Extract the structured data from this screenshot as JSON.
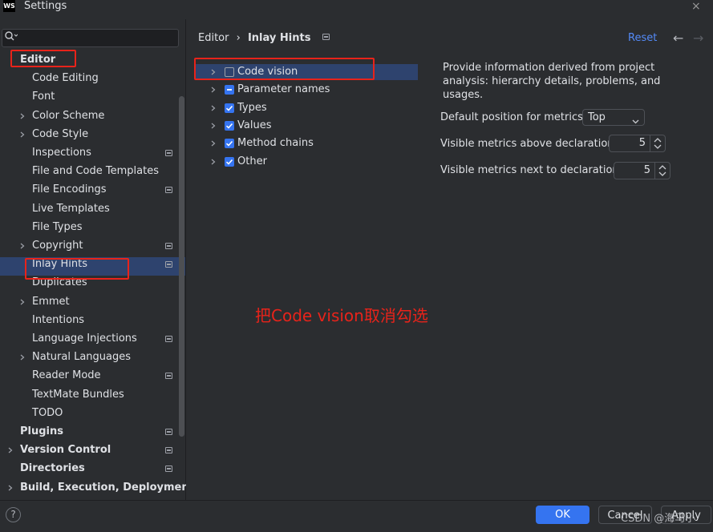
{
  "window": {
    "title": "Settings",
    "logo_text": "WS"
  },
  "search": {
    "placeholder": ""
  },
  "sidebar": {
    "items": [
      {
        "label": "Editor",
        "bold": true,
        "chevron": false,
        "badge": false
      },
      {
        "label": "Code Editing",
        "chevron": false,
        "badge": false
      },
      {
        "label": "Font",
        "chevron": false,
        "badge": false
      },
      {
        "label": "Color Scheme",
        "chevron": true,
        "badge": false
      },
      {
        "label": "Code Style",
        "chevron": true,
        "badge": false
      },
      {
        "label": "Inspections",
        "chevron": false,
        "badge": true
      },
      {
        "label": "File and Code Templates",
        "chevron": false,
        "badge": false
      },
      {
        "label": "File Encodings",
        "chevron": false,
        "badge": true
      },
      {
        "label": "Live Templates",
        "chevron": false,
        "badge": false
      },
      {
        "label": "File Types",
        "chevron": false,
        "badge": false
      },
      {
        "label": "Copyright",
        "chevron": true,
        "badge": true
      },
      {
        "label": "Inlay Hints",
        "chevron": false,
        "badge": true,
        "selected": true
      },
      {
        "label": "Duplicates",
        "chevron": false,
        "badge": false
      },
      {
        "label": "Emmet",
        "chevron": true,
        "badge": false
      },
      {
        "label": "Intentions",
        "chevron": false,
        "badge": false
      },
      {
        "label": "Language Injections",
        "chevron": false,
        "badge": true
      },
      {
        "label": "Natural Languages",
        "chevron": true,
        "badge": false
      },
      {
        "label": "Reader Mode",
        "chevron": false,
        "badge": true
      },
      {
        "label": "TextMate Bundles",
        "chevron": false,
        "badge": false
      },
      {
        "label": "TODO",
        "chevron": false,
        "badge": false
      },
      {
        "label": "Plugins",
        "bold": true,
        "chevron": false,
        "badge": true
      },
      {
        "label": "Version Control",
        "bold": true,
        "chevron": true,
        "badge": true
      },
      {
        "label": "Directories",
        "bold": true,
        "chevron": false,
        "badge": true
      },
      {
        "label": "Build, Execution, Deployment",
        "bold": true,
        "chevron": true,
        "badge": false
      }
    ]
  },
  "breadcrumb": {
    "parent": "Editor",
    "separator": "›",
    "current": "Inlay Hints"
  },
  "header": {
    "reset_label": "Reset",
    "back_glyph": "←",
    "forward_glyph": "→"
  },
  "hints": [
    {
      "label": "Code vision",
      "state": "unchecked"
    },
    {
      "label": "Parameter names",
      "state": "partial"
    },
    {
      "label": "Types",
      "state": "checked"
    },
    {
      "label": "Values",
      "state": "checked"
    },
    {
      "label": "Method chains",
      "state": "checked"
    },
    {
      "label": "Other",
      "state": "checked"
    }
  ],
  "description": "Provide information derived from project analysis: hierarchy details, problems, and usages.",
  "settings": {
    "default_position_label": "Default position for metrics:",
    "default_position_value": "Top",
    "above_label": "Visible metrics above declaration:",
    "above_value": "5",
    "next_label": "Visible metrics next to declaration:",
    "next_value": "5"
  },
  "annotation": "把Code vision取消勾选",
  "footer": {
    "help_glyph": "?",
    "ok_label": "OK",
    "cancel_label": "Cancel",
    "apply_label": "Apply",
    "watermark": "CSDN @海马小"
  },
  "colors": {
    "accent": "#3574f0",
    "selection": "#2e436e",
    "link": "#548af7",
    "annotation_red": "#e8231a"
  }
}
